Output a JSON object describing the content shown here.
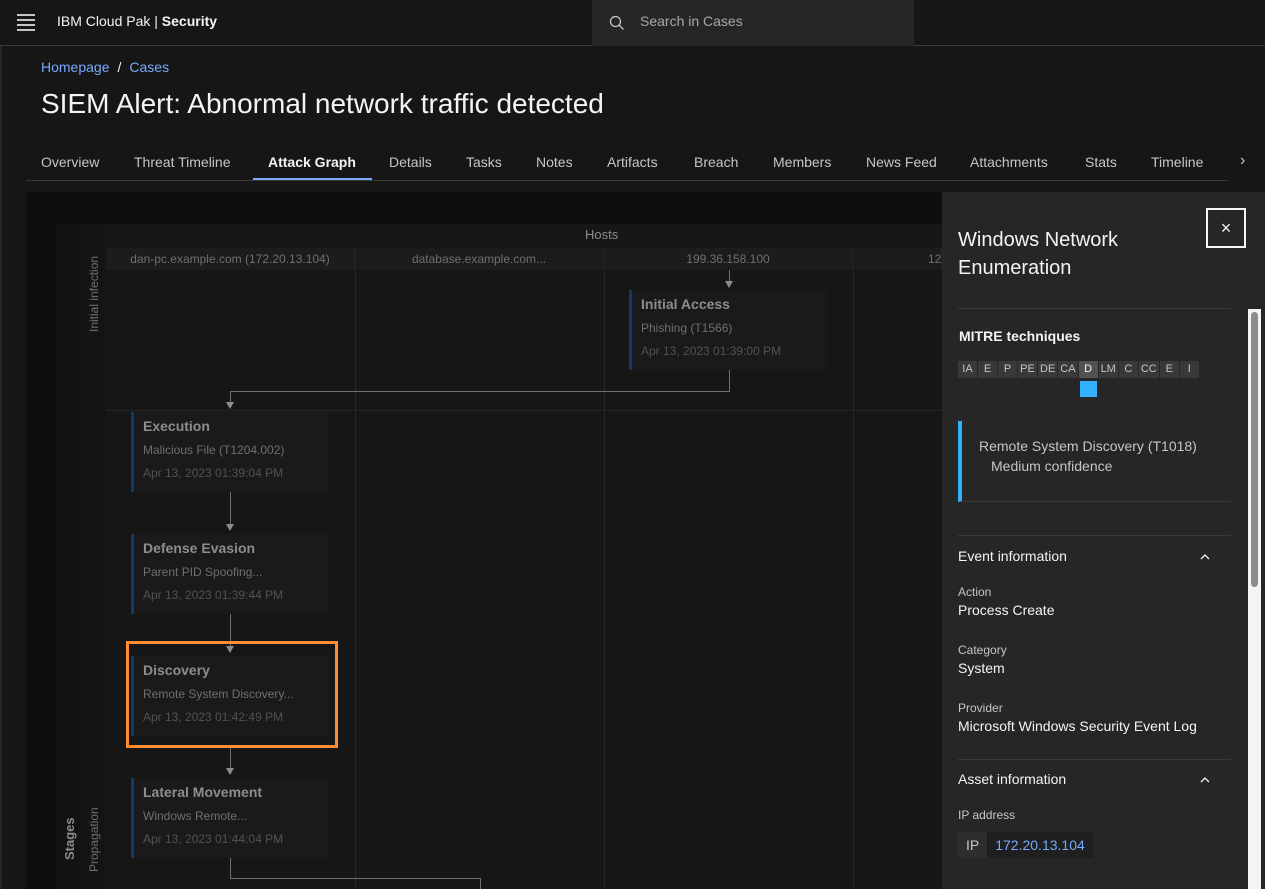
{
  "header": {
    "brand_prefix": "IBM Cloud Pak | ",
    "brand_suffix": "Security",
    "search_placeholder": "Search in Cases"
  },
  "breadcrumb": {
    "home": "Homepage",
    "sep": "/",
    "cases": "Cases"
  },
  "page_title": "SIEM Alert: Abnormal network traffic detected",
  "tabs": [
    "Overview",
    "Threat Timeline",
    "Attack Graph",
    "Details",
    "Tasks",
    "Notes",
    "Artifacts",
    "Breach",
    "Members",
    "News Feed",
    "Attachments",
    "Stats",
    "Timeline"
  ],
  "active_tab": "Attack Graph",
  "graph": {
    "hosts_label": "Hosts",
    "stages_label": "Stages",
    "stage_initial": "Initial infection",
    "stage_propagation": "Propagation",
    "hosts": [
      "dan-pc.example.com (172.20.13.104)",
      "database.example.com...",
      "199.36.158.100",
      "12"
    ],
    "nodes": [
      {
        "title": "Initial Access",
        "sub": "Phishing (T1566)",
        "time": "Apr 13, 2023 01:39:00 PM"
      },
      {
        "title": "Execution",
        "sub": "Malicious File (T1204.002)",
        "time": "Apr 13, 2023 01:39:04 PM"
      },
      {
        "title": "Defense Evasion",
        "sub": "Parent PID Spoofing...",
        "time": "Apr 13, 2023 01:39:44 PM"
      },
      {
        "title": "Discovery",
        "sub": "Remote System Discovery...",
        "time": "Apr 13, 2023 01:42:49 PM"
      },
      {
        "title": "Lateral Movement",
        "sub": "Windows Remote...",
        "time": "Apr 13, 2023 01:44:04 PM"
      }
    ]
  },
  "panel": {
    "title": "Windows Network Enumeration",
    "close": "×",
    "mitre_heading": "MITRE techniques",
    "mitre_chips": [
      "IA",
      "E",
      "P",
      "PE",
      "DE",
      "CA",
      "D",
      "LM",
      "C",
      "CC",
      "E",
      "I"
    ],
    "technique": "Remote System Discovery (T1018)",
    "confidence": "Medium confidence",
    "event_heading": "Event information",
    "action_label": "Action",
    "action_value": "Process Create",
    "category_label": "Category",
    "category_value": "System",
    "provider_label": "Provider",
    "provider_value": "Microsoft Windows Security Event Log",
    "asset_heading": "Asset information",
    "ip_label": "IP address",
    "ip_key": "IP",
    "ip_value": "172.20.13.104"
  },
  "colors": {
    "accent": "#78a9ff",
    "highlight": "#ff8c2e",
    "mitre_selected": "#33b1ff"
  }
}
